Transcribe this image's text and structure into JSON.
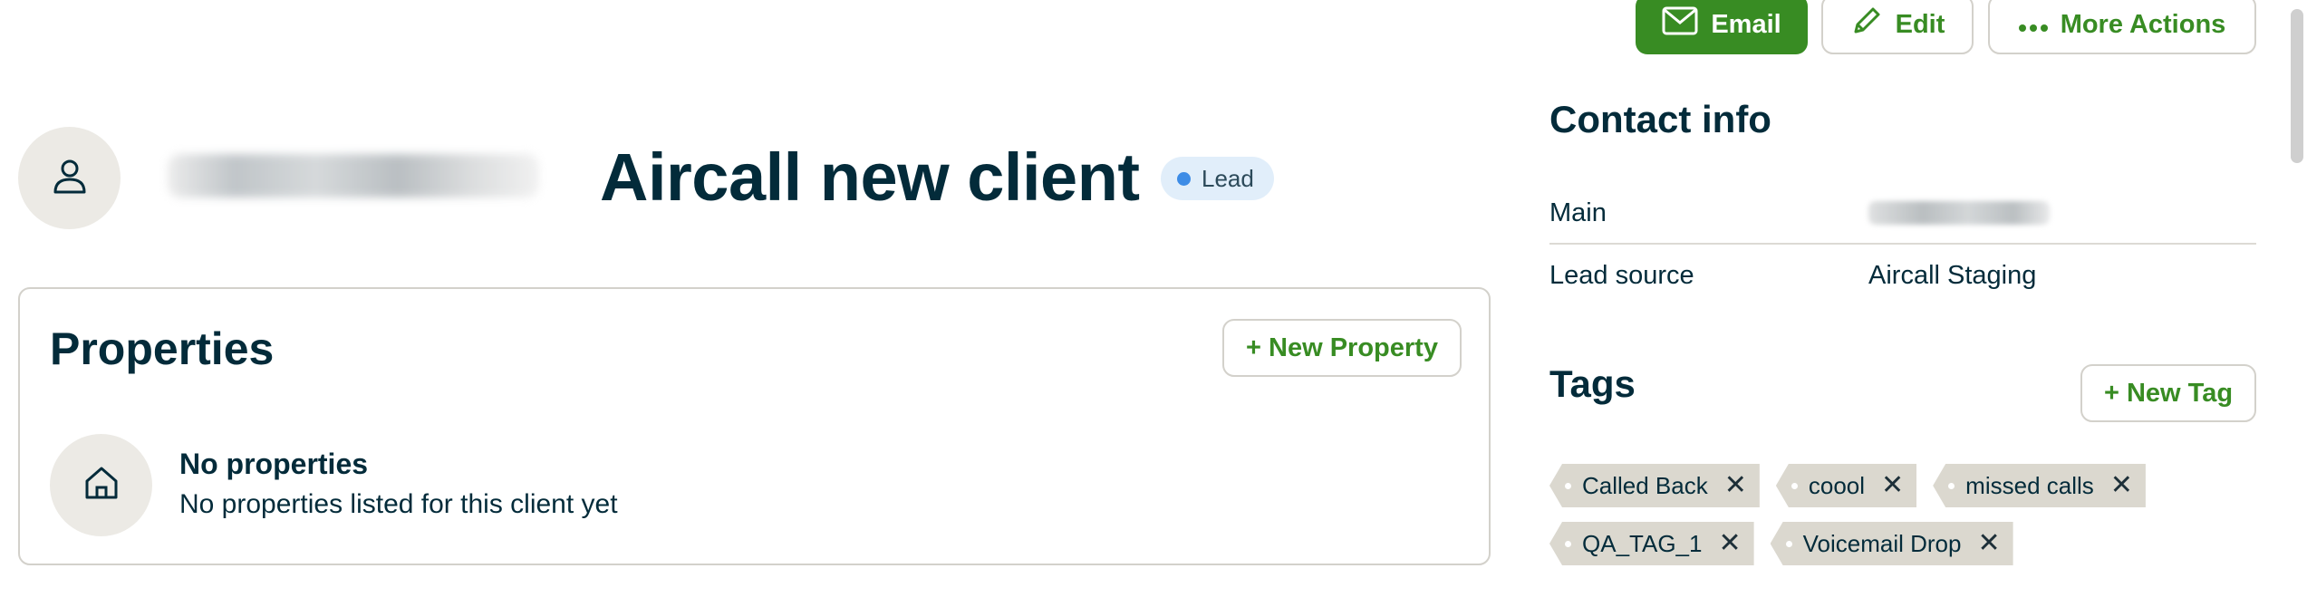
{
  "toolbar": {
    "email_label": "Email",
    "edit_label": "Edit",
    "more_actions_label": "More Actions"
  },
  "header": {
    "client_name": "Aircall new client",
    "status_badge": "Lead"
  },
  "properties": {
    "title": "Properties",
    "new_property_label": "+ New Property",
    "empty_title": "No properties",
    "empty_description": "No properties listed for this client yet"
  },
  "contact_info": {
    "title": "Contact info",
    "rows": [
      {
        "label": "Main",
        "value": ""
      },
      {
        "label": "Lead source",
        "value": "Aircall Staging"
      }
    ]
  },
  "tags": {
    "title": "Tags",
    "new_tag_label": "+ New Tag",
    "items": [
      {
        "label": "Called Back"
      },
      {
        "label": "coool"
      },
      {
        "label": "missed calls"
      },
      {
        "label": "QA_TAG_1"
      },
      {
        "label": "Voicemail Drop"
      }
    ]
  },
  "colors": {
    "accent": "#388c23",
    "text": "#032b3a",
    "badge_bg": "#e1eefa",
    "badge_dot": "#3d8ce6",
    "tag_bg": "#dbd8cf"
  }
}
